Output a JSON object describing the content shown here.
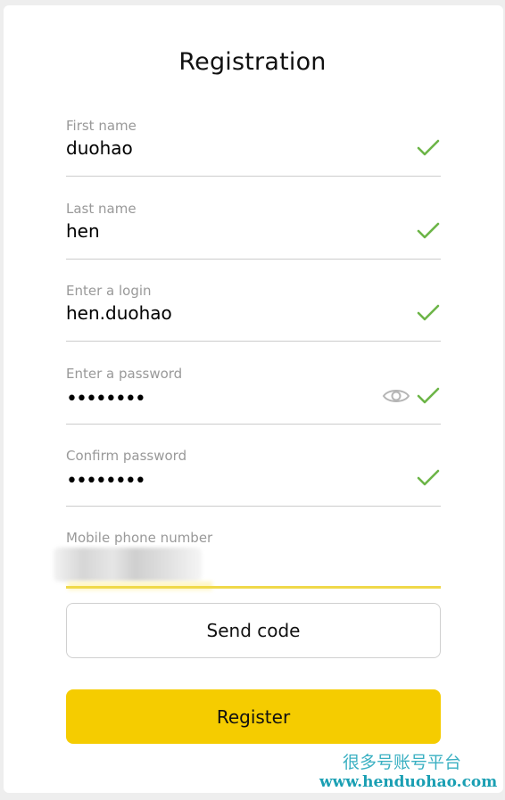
{
  "form": {
    "title": "Registration",
    "fields": [
      {
        "label": "First name",
        "value": "duohao",
        "valid": true
      },
      {
        "label": "Last name",
        "value": "hen",
        "valid": true
      },
      {
        "label": "Enter a login",
        "value": "hen.duohao",
        "valid": true
      },
      {
        "label": "Enter a password",
        "value": "••••••••",
        "valid": true,
        "icon": "eye-icon"
      },
      {
        "label": "Confirm password",
        "value": "••••••••",
        "valid": true
      },
      {
        "label": "Mobile phone number",
        "value": "",
        "active": true
      }
    ],
    "send_code_label": "Send code",
    "register_label": "Register"
  },
  "watermark": {
    "text": "很多号账号平台",
    "url": "www.henduohao.com"
  },
  "colors": {
    "check": "#6cb547",
    "accent": "#f5cc00",
    "active_underline": "#f0d94a",
    "watermark": "#3ab0c2"
  }
}
